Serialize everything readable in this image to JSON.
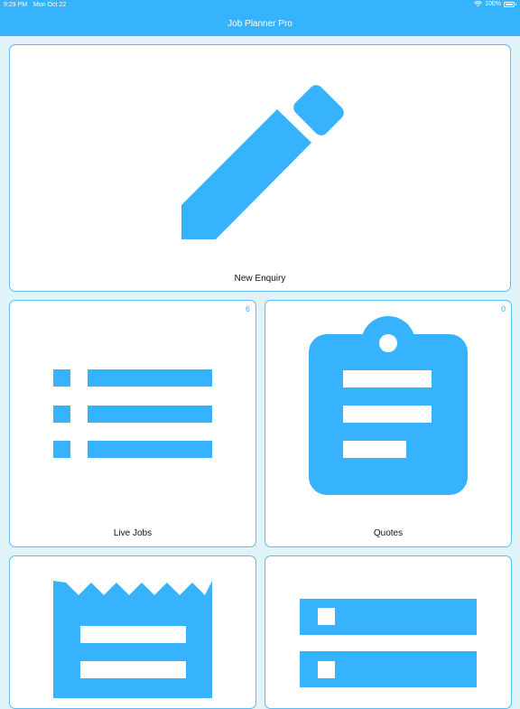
{
  "status_bar": {
    "time": "9:29 PM",
    "date": "Mon Oct 22",
    "battery": "100%",
    "wifi_icon": "wifi-icon",
    "battery_icon": "battery-icon"
  },
  "nav": {
    "title": "Job Planner Pro"
  },
  "tiles": [
    {
      "label": "New Enquiry",
      "icon": "pencil-icon"
    },
    {
      "label": "Live Jobs",
      "count": "6",
      "icon": "list-icon"
    },
    {
      "label": "Quotes",
      "count": "0",
      "icon": "clipboard-icon"
    },
    {
      "label": "",
      "icon": "receipt-icon"
    },
    {
      "label": "",
      "icon": "checklist-icon"
    }
  ],
  "colors": {
    "accent": "#37b2fd",
    "background": "#dff3f8",
    "tile_border": "#5cbcf4"
  }
}
